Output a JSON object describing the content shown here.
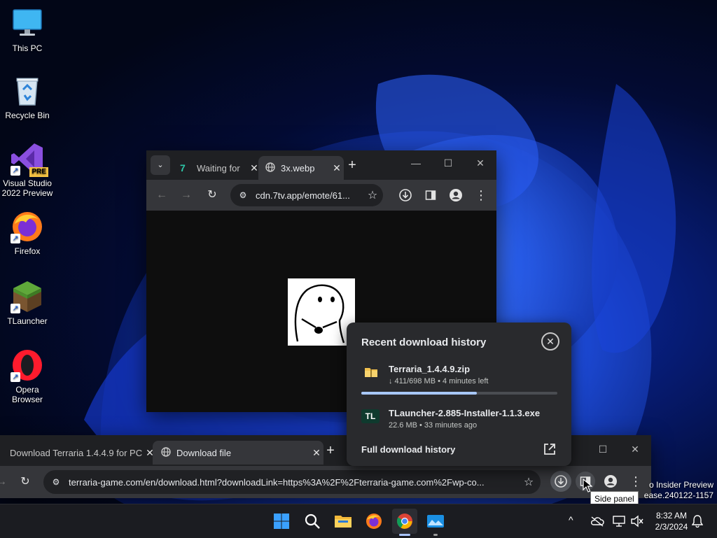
{
  "desktop": {
    "icons": [
      {
        "label": "This PC"
      },
      {
        "label": "Recycle Bin"
      },
      {
        "label": "Visual Studio 2022 Preview",
        "badge": "PRE"
      },
      {
        "label": "Firefox"
      },
      {
        "label": "TLauncher"
      },
      {
        "label": "Opera Browser"
      }
    ]
  },
  "window_top": {
    "tabs": [
      {
        "title": "Waiting for"
      },
      {
        "title": "3x.webp"
      }
    ],
    "url": "cdn.7tv.app/emote/61..."
  },
  "window_bottom": {
    "tabs": [
      {
        "title": "Download Terraria 1.4.4.9 for PC"
      },
      {
        "title": "Download file"
      }
    ],
    "url": "terraria-game.com/en/download.html?downloadLink=https%3A%2F%2Fterraria-game.com%2Fwp-co..."
  },
  "downloads": {
    "heading": "Recent download history",
    "items": [
      {
        "name": "Terraria_1.4.4.9.zip",
        "status": "↓ 411/698 MB • 4 minutes left",
        "icon": "folder-zip-icon",
        "progress": 0.59
      },
      {
        "name": "TLauncher-2.885-Installer-1.1.3.exe",
        "status": "22.6 MB • 33 minutes ago",
        "icon_text": "TL"
      }
    ],
    "full_history_label": "Full download history"
  },
  "tooltip": "Side panel",
  "watermark": {
    "line1": "o Insider Preview",
    "line2": "ease.240122-1157"
  },
  "clock": {
    "time": "8:32 AM",
    "date": "2/3/2024"
  },
  "colors": {
    "accent": "#a8c7fa",
    "taskbar": "#1b1c21",
    "chrome_toolbar": "#35363a"
  }
}
